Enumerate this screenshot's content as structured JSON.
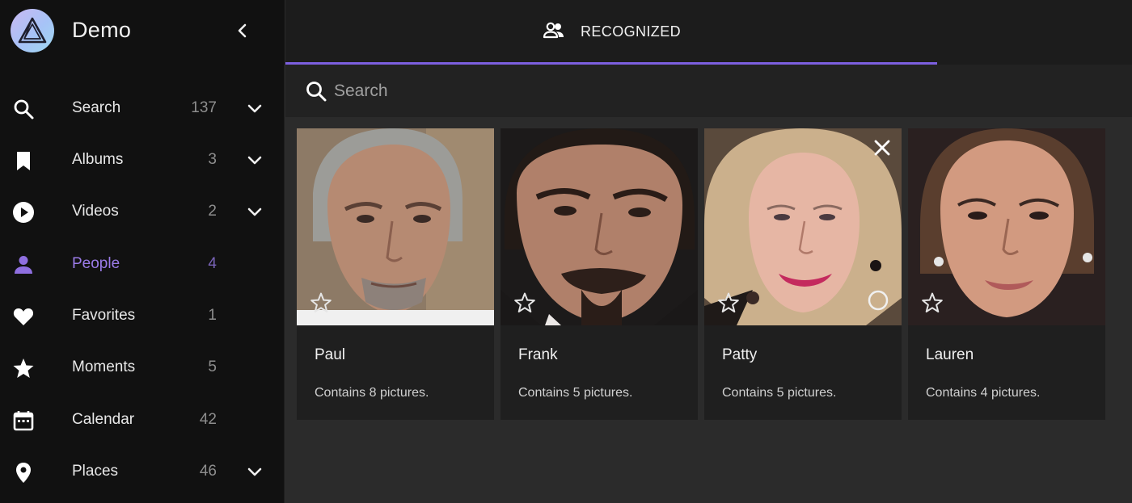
{
  "app": {
    "title": "Demo"
  },
  "icons": {
    "logo": "prism-logo-icon",
    "collapse": "chevron-left-icon"
  },
  "sidebar": {
    "items": [
      {
        "label": "Search",
        "count": "137",
        "icon": "search-icon",
        "expandable": true,
        "active": false
      },
      {
        "label": "Albums",
        "count": "3",
        "icon": "bookmark-icon",
        "expandable": true,
        "active": false
      },
      {
        "label": "Videos",
        "count": "2",
        "icon": "play-circle-icon",
        "expandable": true,
        "active": false
      },
      {
        "label": "People",
        "count": "4",
        "icon": "person-icon",
        "expandable": false,
        "active": true
      },
      {
        "label": "Favorites",
        "count": "1",
        "icon": "heart-icon",
        "expandable": false,
        "active": false
      },
      {
        "label": "Moments",
        "count": "5",
        "icon": "star-icon",
        "expandable": false,
        "active": false
      },
      {
        "label": "Calendar",
        "count": "42",
        "icon": "calendar-icon",
        "expandable": false,
        "active": false
      },
      {
        "label": "Places",
        "count": "46",
        "icon": "place-icon",
        "expandable": true,
        "active": false
      }
    ]
  },
  "tabs": [
    {
      "label": "RECOGNIZED",
      "icon": "people-icon",
      "active": true
    }
  ],
  "search": {
    "placeholder": "Search",
    "value": ""
  },
  "people": [
    {
      "name": "Paul",
      "description": "Contains 8 pictures.",
      "favorite": false,
      "show_remove": false
    },
    {
      "name": "Frank",
      "description": "Contains 5 pictures.",
      "favorite": false,
      "show_remove": false
    },
    {
      "name": "Patty",
      "description": "Contains 5 pictures.",
      "favorite": false,
      "show_remove": true
    },
    {
      "name": "Lauren",
      "description": "Contains 4 pictures.",
      "favorite": false,
      "show_remove": false
    }
  ],
  "colors": {
    "accent": "#7c5fe0",
    "accent_text": "#9b7be8",
    "sidebar_bg": "#111111",
    "content_bg": "#2b2b2b",
    "card_bg": "#1f1f1f"
  }
}
